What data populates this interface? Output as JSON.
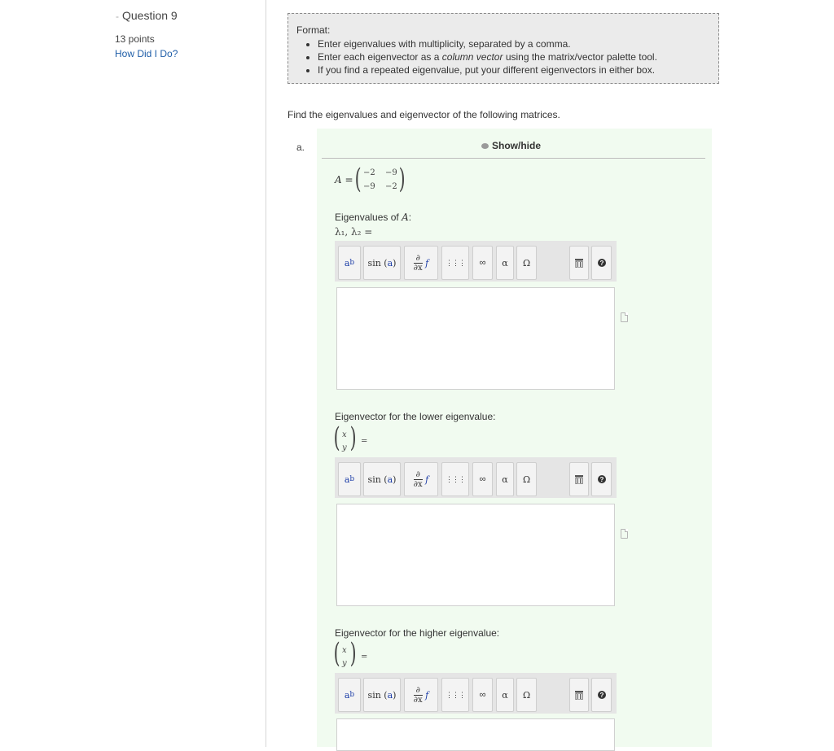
{
  "sidebar": {
    "question_title": "Question 9",
    "points": "13 points",
    "how_did_i_do": "How Did I Do?"
  },
  "format": {
    "heading": "Format:",
    "items": [
      "Enter eigenvalues with multiplicity, separated by a comma.",
      "Enter each eigenvector as a",
      "column vector",
      "using the matrix/vector palette tool.",
      "If you find a repeated eigenvalue, put your different eigenvectors in either box."
    ]
  },
  "instruction": "Find the eigenvalues and eigenvector of the following matrices.",
  "part": {
    "label": "a.",
    "show_hide": "Show/hide",
    "matrix": {
      "lhs": "A =",
      "cells": [
        "−2",
        "−9",
        "−9",
        "−2"
      ]
    },
    "eigenvalues_label": "Eigenvalues of",
    "eigenvalues_var": "A",
    "eigenvalues_colon": ":",
    "lambda_expr": "λ₁, λ₂ =",
    "lower_label": "Eigenvector for the lower eigenvalue:",
    "higher_label": "Eigenvector for the higher eigenvalue:",
    "vector_x": "x",
    "vector_y": "y",
    "vector_eq": "="
  },
  "toolbar": {
    "power_base": "a",
    "power_exp": "b",
    "sin_label": "sin",
    "sin_arg": "a",
    "deriv_top": "∂",
    "deriv_bottom": "∂x",
    "deriv_f": "f",
    "matrix_icon": "⋮⋮⋮",
    "infinity": "∞",
    "alpha": "α",
    "omega": "Ω",
    "trash_icon": "trash-icon",
    "help_icon": "help-icon"
  },
  "colors": {
    "link": "#1f5ea8",
    "panel_bg": "#f1fbf0",
    "format_bg": "#ebebeb",
    "toolbar_bg": "#e5e5e5"
  }
}
